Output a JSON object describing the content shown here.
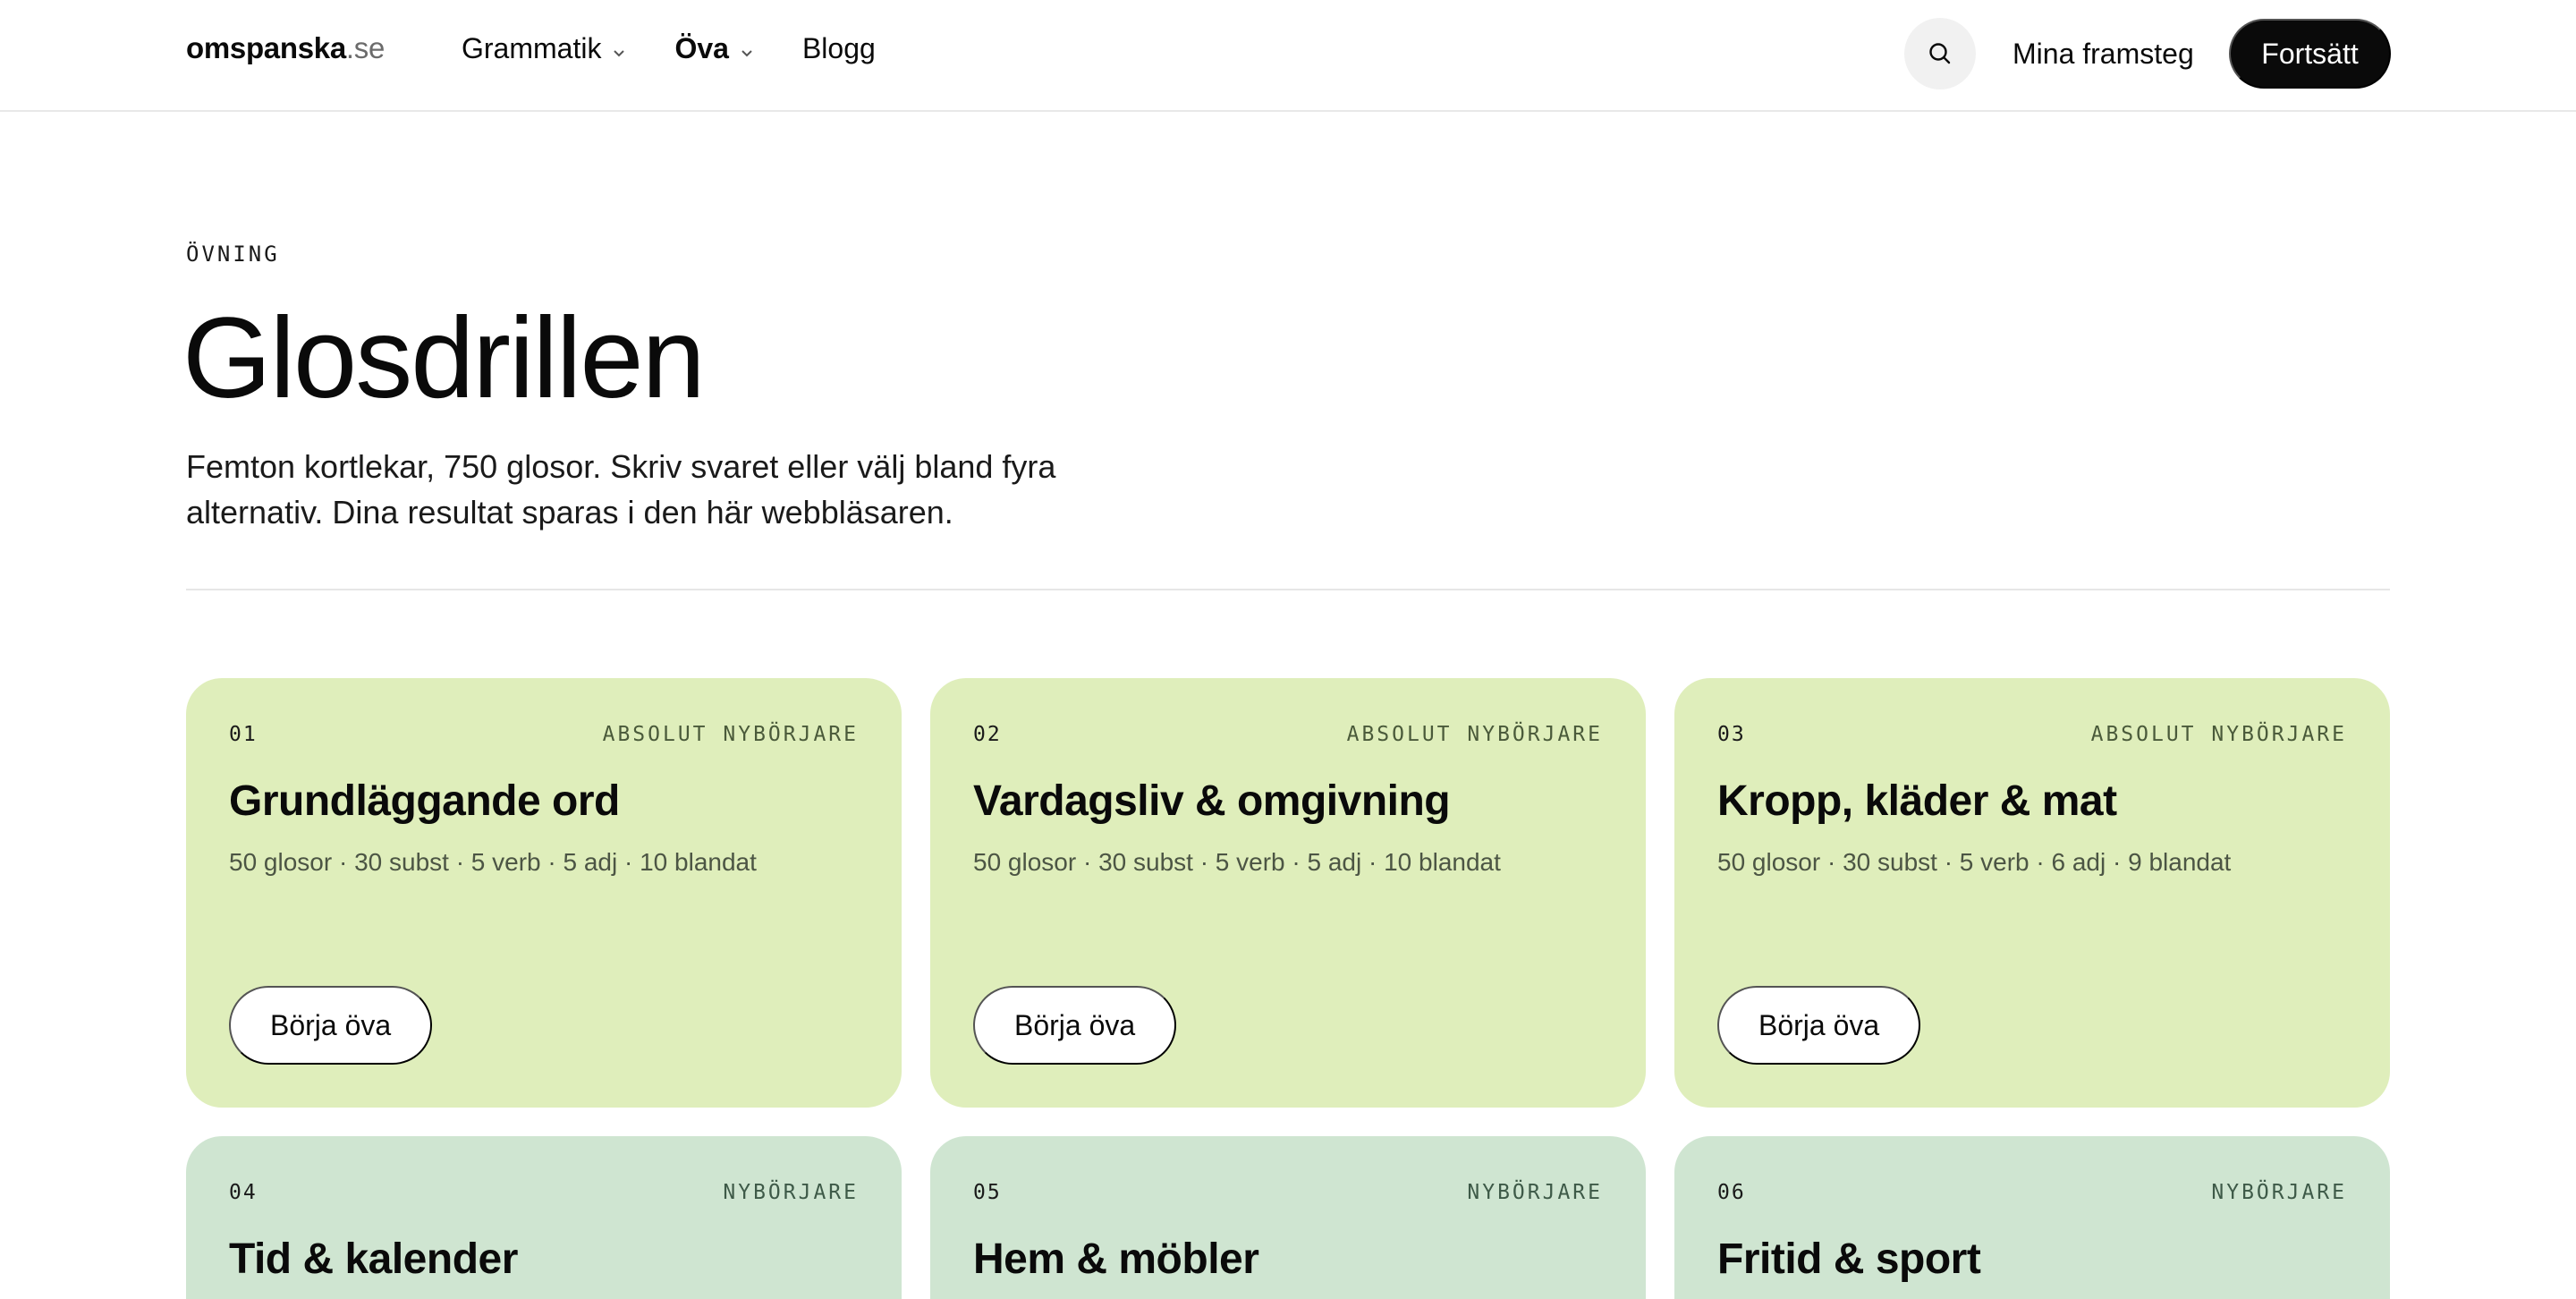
{
  "header": {
    "logo_brand": "omspanska",
    "logo_tld": ".se",
    "nav": [
      {
        "label": "Grammatik",
        "has_dropdown": true,
        "active": false
      },
      {
        "label": "Öva",
        "has_dropdown": true,
        "active": true
      },
      {
        "label": "Blogg",
        "has_dropdown": false,
        "active": false
      }
    ],
    "search_icon": "search-icon",
    "progress_label": "Mina framsteg",
    "continue_label": "Fortsätt"
  },
  "hero": {
    "eyebrow": "ÖVNING",
    "title": "Glosdrillen",
    "lead": "Femton kortlekar, 750 glosor. Skriv svaret eller välj bland fyra alternativ. Dina resultat sparas i den här webbläsaren."
  },
  "cards": [
    {
      "num": "01",
      "level": "ABSOLUT NYBÖRJARE",
      "title": "Grundläggande ord",
      "meta": "50 glosor · 30 subst · 5 verb · 5 adj · 10 blandat",
      "button": "Börja öva",
      "color": "#dfeebb"
    },
    {
      "num": "02",
      "level": "ABSOLUT NYBÖRJARE",
      "title": "Vardagsliv & omgivning",
      "meta": "50 glosor · 30 subst · 5 verb · 5 adj · 10 blandat",
      "button": "Börja öva",
      "color": "#dfeebb"
    },
    {
      "num": "03",
      "level": "ABSOLUT NYBÖRJARE",
      "title": "Kropp, kläder & mat",
      "meta": "50 glosor · 30 subst · 5 verb · 6 adj · 9 blandat",
      "button": "Börja öva",
      "color": "#dfeebb"
    },
    {
      "num": "04",
      "level": "NYBÖRJARE",
      "title": "Tid & kalender",
      "color": "#cfe5d1"
    },
    {
      "num": "05",
      "level": "NYBÖRJARE",
      "title": "Hem & möbler",
      "color": "#cfe5d1"
    },
    {
      "num": "06",
      "level": "NYBÖRJARE",
      "title": "Fritid & sport",
      "color": "#cfe5d1"
    }
  ]
}
